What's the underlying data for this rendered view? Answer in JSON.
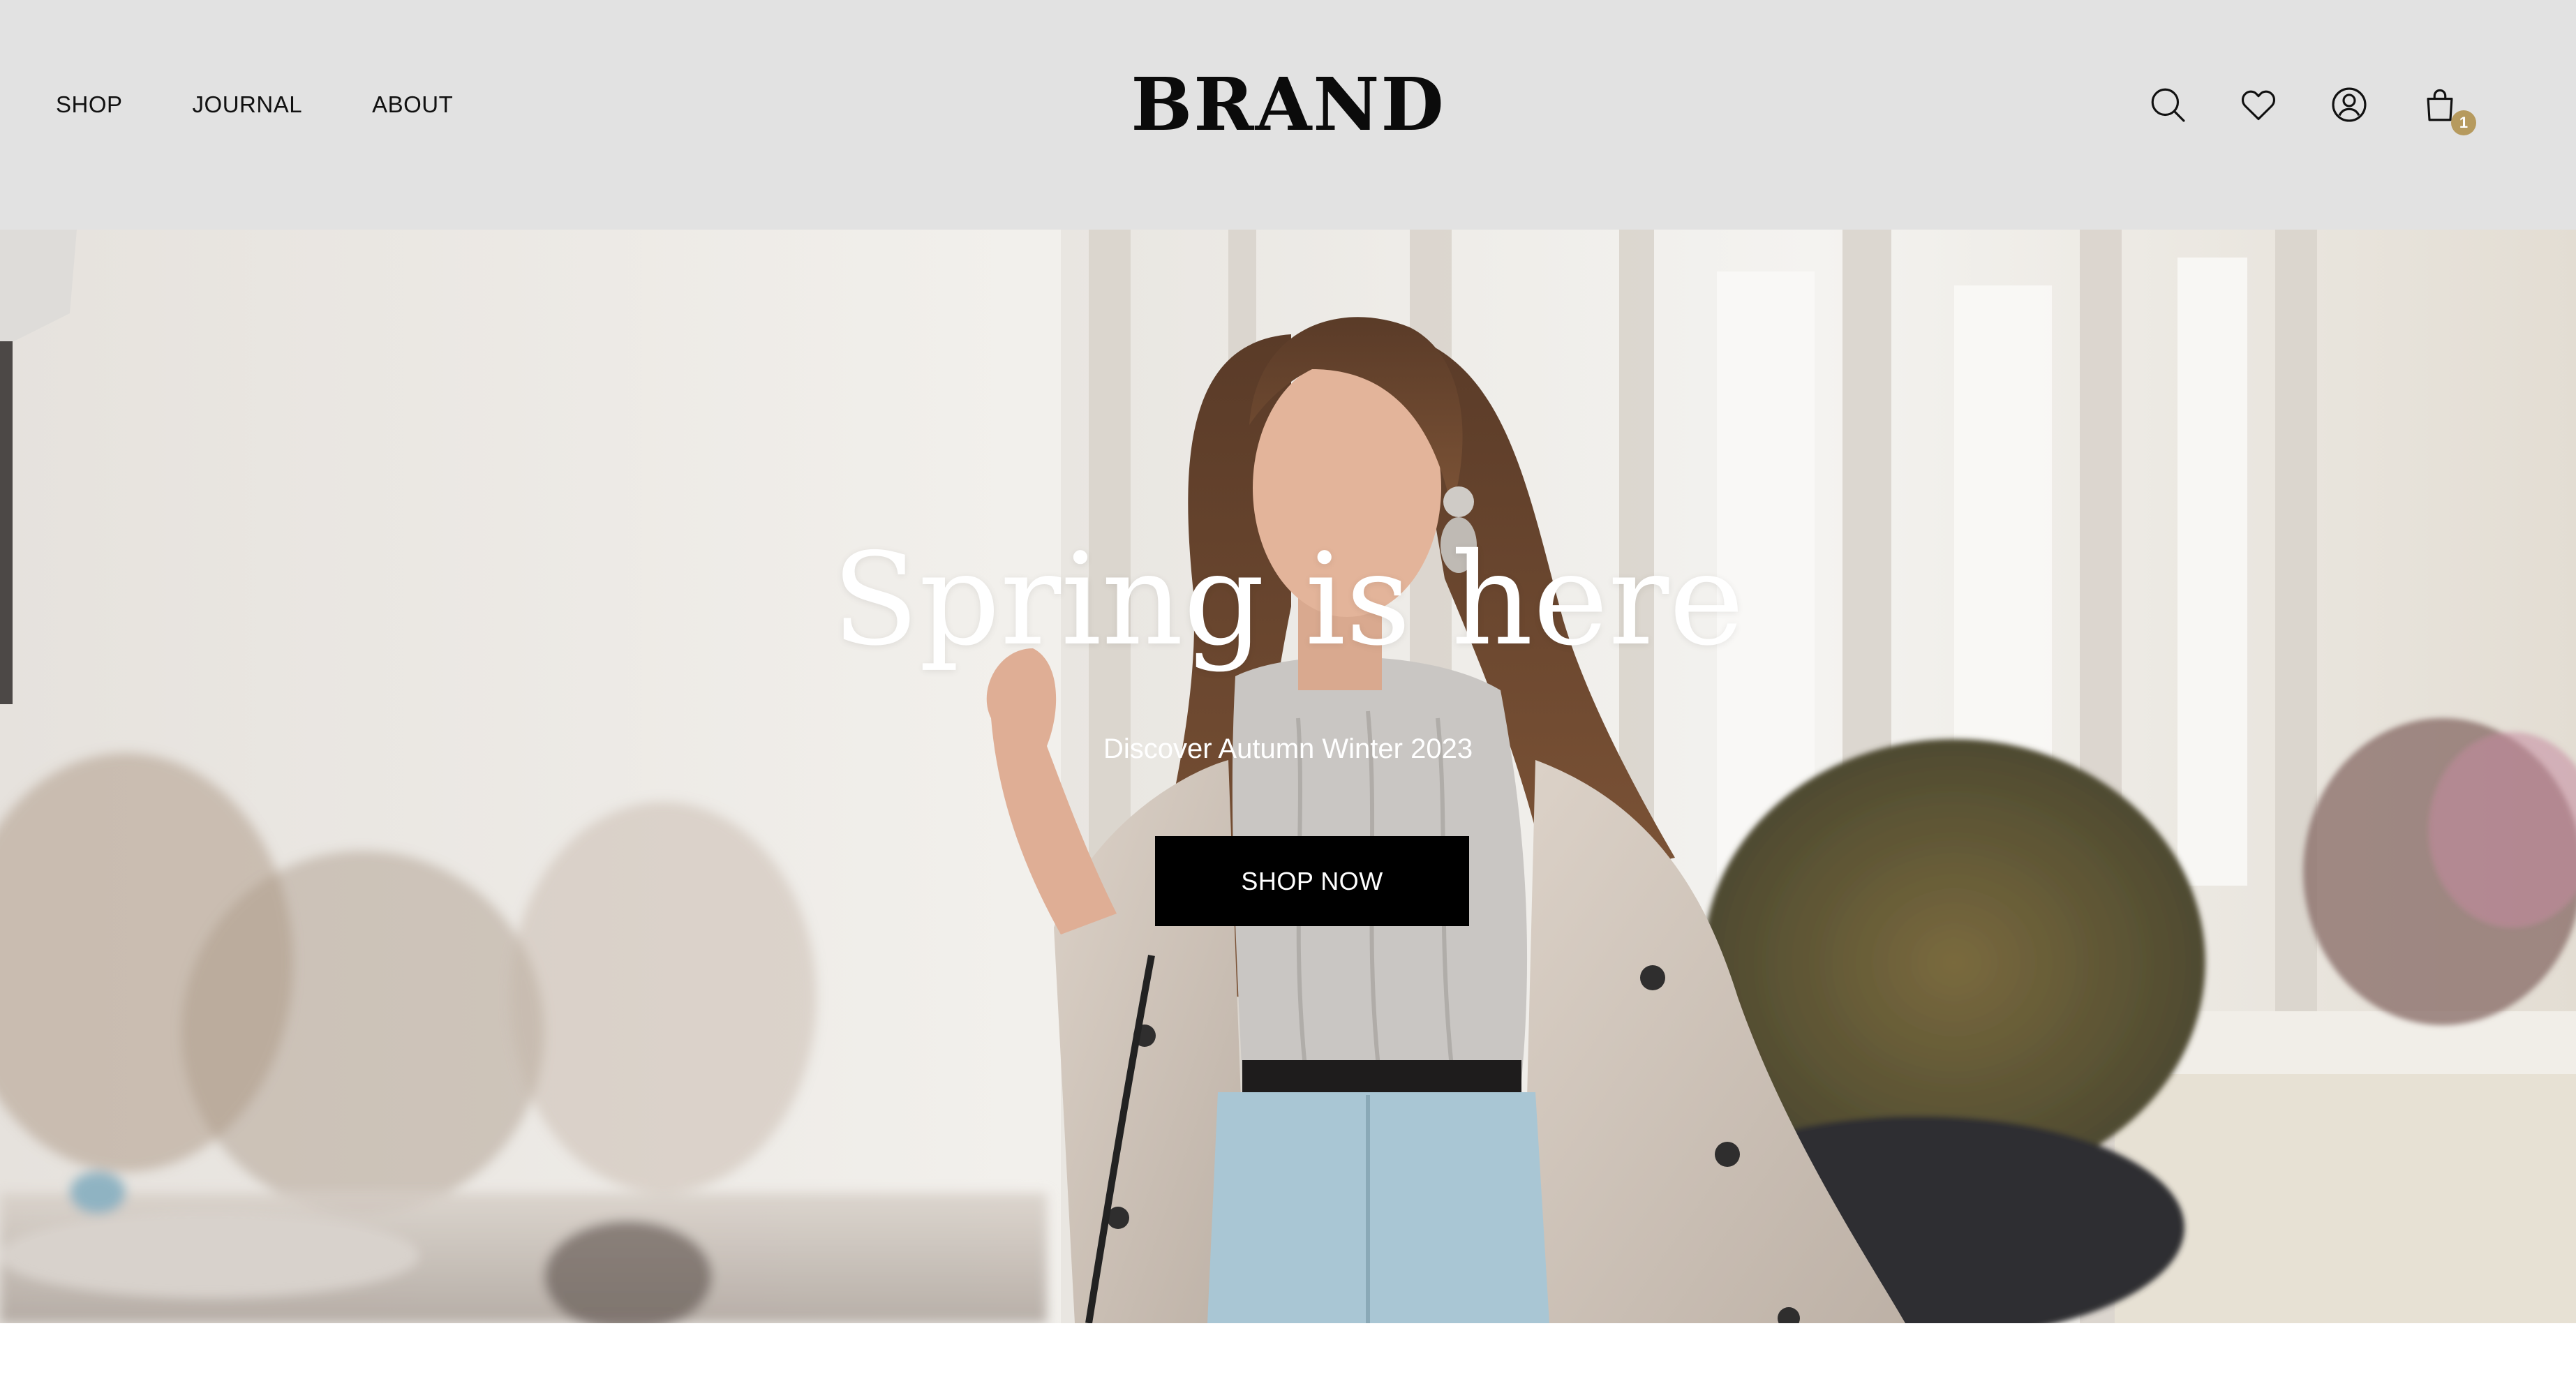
{
  "header": {
    "nav": [
      {
        "label": "SHOP"
      },
      {
        "label": "JOURNAL"
      },
      {
        "label": "ABOUT"
      }
    ],
    "brand": "BRAND",
    "icons": [
      "search-icon",
      "heart-icon",
      "user-icon",
      "shopping-bag-icon"
    ],
    "cart_count": "1",
    "badge_color": "#b69a5e",
    "background": "#e2e2e2"
  },
  "hero": {
    "title": "Spring is here",
    "subtitle": "Discover Autumn Winter 2023",
    "cta_label": "SHOP NOW",
    "cta_color": "#000000"
  }
}
